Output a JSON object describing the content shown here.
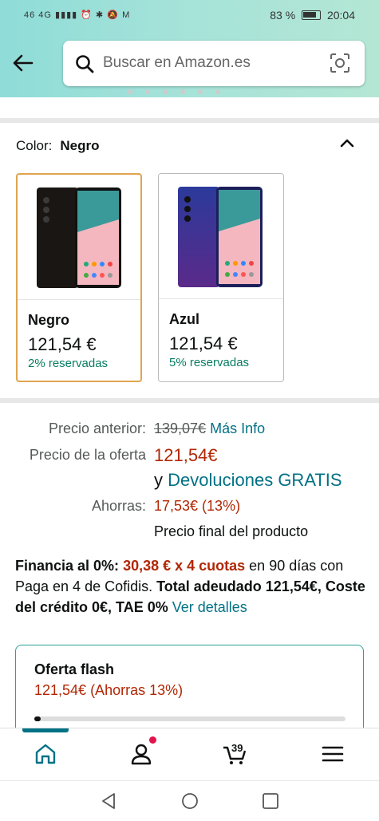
{
  "status": {
    "left": "46 4G ▮▮▮▮ ⏰ ✱ 🔕 M",
    "battery": "83 %",
    "time": "20:04"
  },
  "header": {
    "search_placeholder": "Buscar en Amazon.es"
  },
  "color": {
    "label": "Color:",
    "selected": "Negro",
    "options": [
      {
        "name": "Negro",
        "price": "121,54 €",
        "reserved": "2% reservadas"
      },
      {
        "name": "Azul",
        "price": "121,54 €",
        "reserved": "5% reservadas"
      }
    ]
  },
  "pricing": {
    "previous_label": "Precio anterior:",
    "previous_value": "139,07€",
    "more_info": "Más Info",
    "offer_label": "Precio de la oferta",
    "offer_value": "121,54€",
    "returns_prefix": "y",
    "returns_link": "Devoluciones GRATIS",
    "savings_label": "Ahorras:",
    "savings_value": "17,53€ (13%)",
    "final_note": "Precio final del producto"
  },
  "finance": {
    "lead": "Financia al 0%:",
    "installment": "30,38 € x 4 cuotas",
    "mid": " en 90 días con Paga en 4 de Cofidis. ",
    "total": "Total adeudado 121,54€, Coste del crédito 0€, TAE 0%",
    "link": "Ver detalles"
  },
  "flash": {
    "title": "Oferta flash",
    "price": "121,54€ (Ahorras 13%)",
    "claimed_fraction": 0.02
  },
  "tabs": {
    "cart_count": "39"
  },
  "colors": {
    "accent": "#007185",
    "price_red": "#b12704",
    "green": "#067d62",
    "selected_border": "#e0a450",
    "header_teal": "#a6e3d9"
  }
}
